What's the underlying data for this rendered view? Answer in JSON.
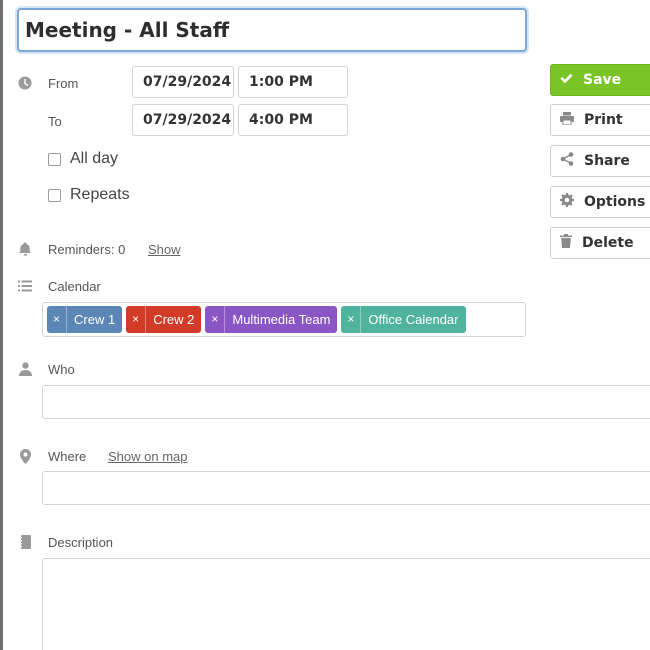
{
  "event": {
    "title": "Meeting - All Staff"
  },
  "time": {
    "from_label": "From",
    "to_label": "To",
    "from_date": "07/29/2024",
    "from_time": "1:00 PM",
    "to_date": "07/29/2024",
    "to_time": "4:00 PM"
  },
  "options": {
    "all_day_label": "All day",
    "repeats_label": "Repeats"
  },
  "reminders": {
    "label": "Reminders: 0",
    "show_link": "Show"
  },
  "calendar": {
    "label": "Calendar",
    "remove_glyph": "×",
    "tags": [
      {
        "name": "Crew 1",
        "color": "#5b86b5"
      },
      {
        "name": "Crew 2",
        "color": "#d23b27"
      },
      {
        "name": "Multimedia Team",
        "color": "#8a55c4"
      },
      {
        "name": "Office Calendar",
        "color": "#4fb39d"
      }
    ]
  },
  "who": {
    "label": "Who",
    "value": ""
  },
  "where": {
    "label": "Where",
    "map_link": "Show on map",
    "value": ""
  },
  "description": {
    "label": "Description",
    "value": ""
  },
  "actions": {
    "save": "Save",
    "print": "Print",
    "share": "Share",
    "options": "Options",
    "delete": "Delete"
  },
  "icons": {
    "time": "clock-icon",
    "reminder": "bell-icon",
    "calendar": "list-icon",
    "who": "person-icon",
    "where": "map-pin-icon",
    "description": "notebook-icon"
  }
}
